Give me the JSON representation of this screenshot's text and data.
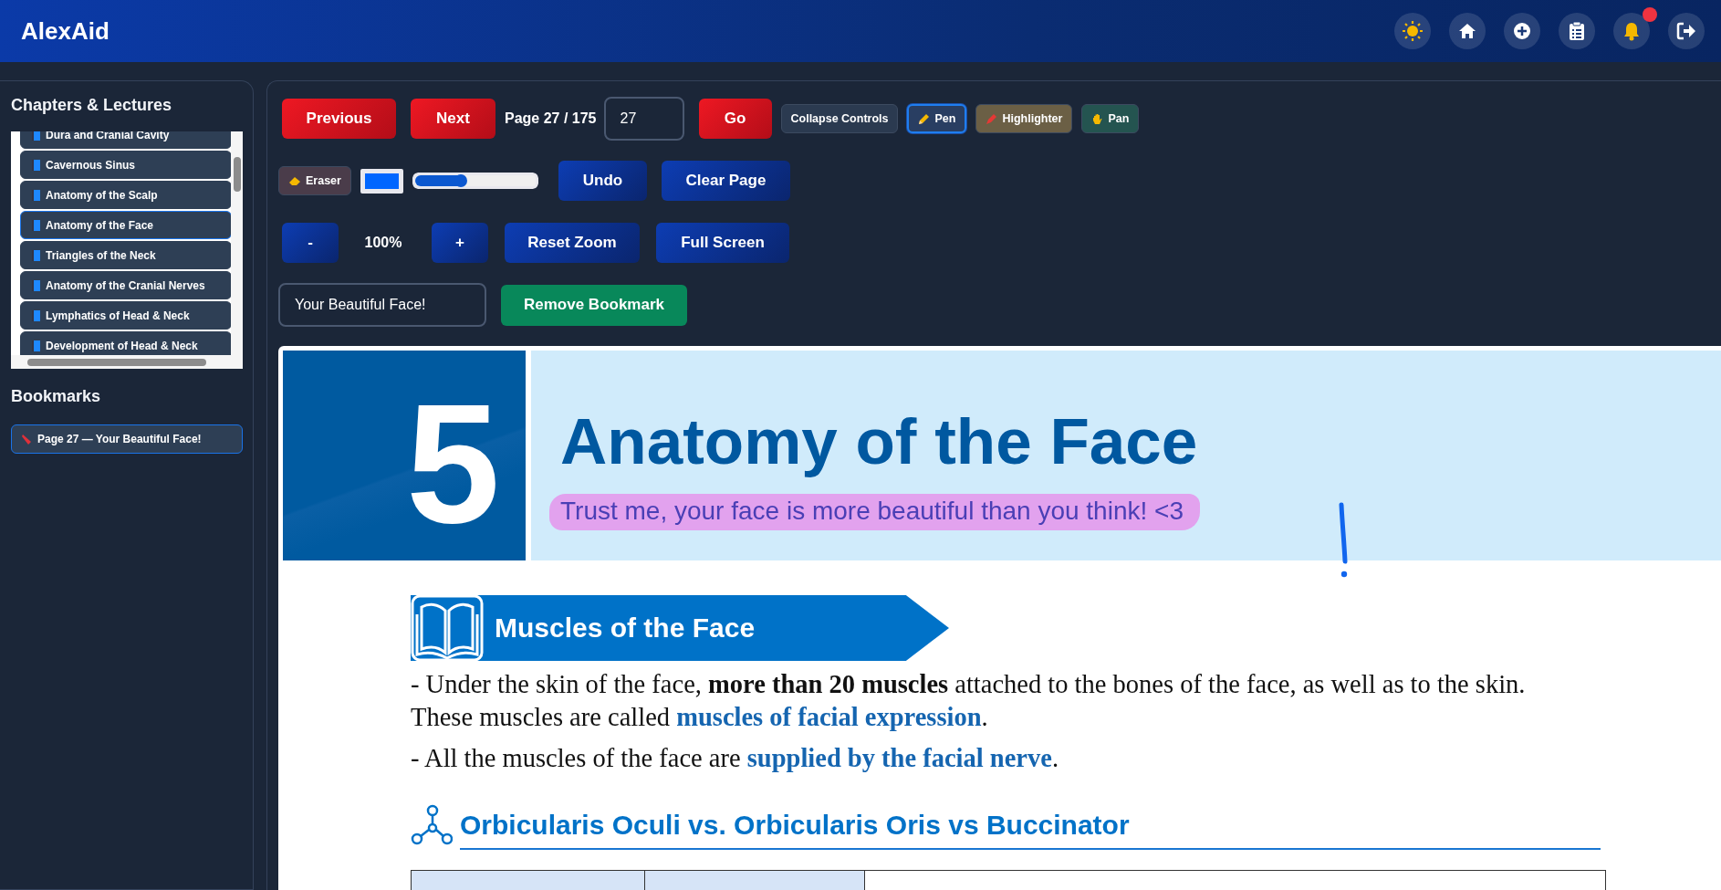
{
  "app": {
    "title": "AlexAid"
  },
  "notifications": {
    "unread": true
  },
  "sidebar": {
    "chapters_title": "Chapters & Lectures",
    "chapters": [
      {
        "label": "Dura and Cranial Cavity",
        "selected": false
      },
      {
        "label": "Cavernous Sinus",
        "selected": false
      },
      {
        "label": "Anatomy of the Scalp",
        "selected": false
      },
      {
        "label": "Anatomy of the Face",
        "selected": true
      },
      {
        "label": "Triangles of the Neck",
        "selected": false
      },
      {
        "label": "Anatomy of the Cranial Nerves",
        "selected": false
      },
      {
        "label": "Lymphatics of Head & Neck",
        "selected": false
      },
      {
        "label": "Development of Head & Neck",
        "selected": false
      }
    ],
    "bookmarks_title": "Bookmarks",
    "bookmarks": [
      {
        "label": "Page 27 — Your Beautiful Face!"
      }
    ]
  },
  "toolbar": {
    "previous": "Previous",
    "next": "Next",
    "page_label": "Page 27 / 175",
    "page_input": {
      "value": "27"
    },
    "go": "Go",
    "collapse": "Collapse Controls",
    "tools": [
      {
        "label": "Pen",
        "kind": "pen",
        "selected": true
      },
      {
        "label": "Highlighter",
        "kind": "highlighter",
        "selected": false
      },
      {
        "label": "Pan",
        "kind": "pan",
        "selected": false
      }
    ],
    "eraser": {
      "label": "Eraser",
      "selected": false
    },
    "pen_color": {
      "color": "#0066ff"
    },
    "pen_size": {
      "level": 0.38
    },
    "undo": "Undo",
    "clear": "Clear Page",
    "zoom_out": "-",
    "zoom_level": "100%",
    "zoom_in": "+",
    "reset_zoom": "Reset Zoom",
    "full_screen": "Full Screen",
    "bookmark_input": {
      "value": "Your Beautiful Face!"
    },
    "remove_bookmark": "Remove Bookmark"
  },
  "document": {
    "chapter_number": "5",
    "title": "Anatomy of the Face",
    "subtitle": "Trust me, your face is more beautiful than you think! <3",
    "section_title": "Muscles of the Face",
    "paragraphs": [
      {
        "lines": [
          [
            {
              "kind": "plain",
              "text": "- Under the skin of the face, "
            },
            {
              "kind": "bold",
              "text": "more than 20 muscles"
            },
            {
              "kind": "plain",
              "text": " attached to the bones of the face, as well as to the skin."
            }
          ],
          [
            {
              "kind": "plain",
              "text": "These muscles are called "
            },
            {
              "kind": "term",
              "text": "muscles of facial expression"
            },
            {
              "kind": "plain",
              "text": "."
            }
          ]
        ]
      },
      {
        "lines": [
          [
            {
              "kind": "plain",
              "text": "- All the muscles of the face are "
            },
            {
              "kind": "term",
              "text": "supplied by the facial nerve"
            },
            {
              "kind": "plain",
              "text": "."
            }
          ]
        ]
      }
    ],
    "subsection_title": "Orbicularis Oculi vs. Orbicularis Oris vs Buccinator"
  }
}
